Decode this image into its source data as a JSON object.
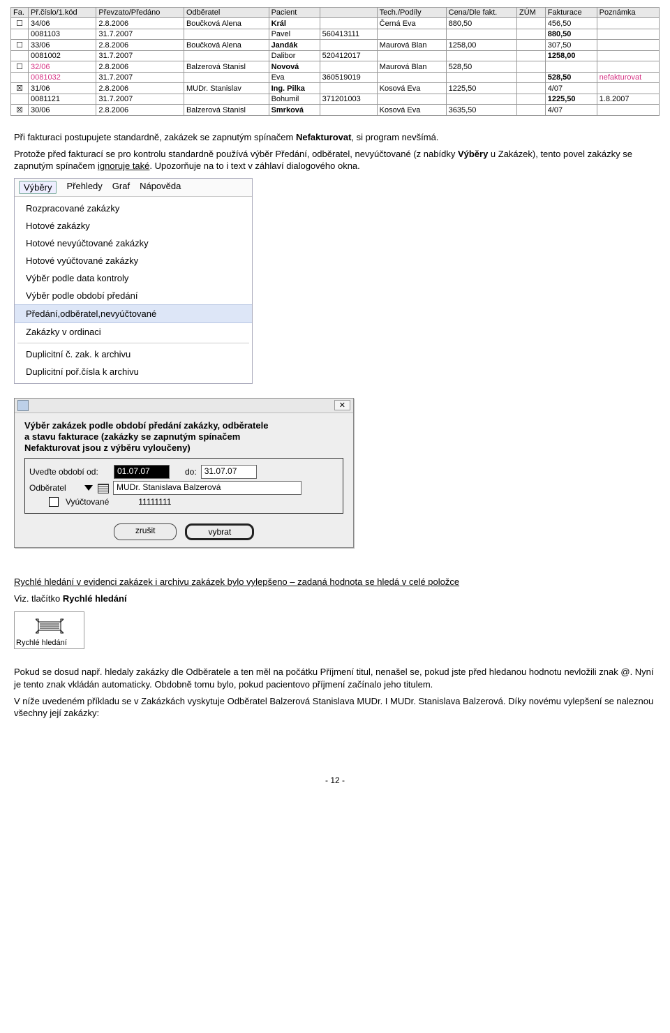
{
  "table": {
    "headers": [
      "Fa.",
      "Př.číslo/1.kód",
      "Převzato/Předáno",
      "Odběratel",
      "Pacient",
      "",
      "Tech./Podíly",
      "Cena/Dle fakt.",
      "ZÚM",
      "Fakturace",
      "Poznámka"
    ],
    "rows": [
      {
        "chk": "☐",
        "c1": "34/06",
        "c2": "2.8.2006",
        "c3": "Boučková Alena",
        "c4": "Král",
        "c5": "",
        "c6": "Černá Eva",
        "c7": "880,50",
        "c8": "",
        "c9": "456,50",
        "c10": "",
        "pink": false,
        "bold4": true
      },
      {
        "chk": "",
        "c1": "0081103",
        "c2": "31.7.2007",
        "c3": "",
        "c4": "Pavel",
        "c5": "560413111",
        "c6": "",
        "c7": "",
        "c8": "",
        "c9": "880,50",
        "c10": "",
        "pink": false,
        "bold9": true
      },
      {
        "chk": "☐",
        "c1": "33/06",
        "c2": "2.8.2006",
        "c3": "Boučková Alena",
        "c4": "Jandák",
        "c5": "",
        "c6": "Maurová Blan",
        "c7": "1258,00",
        "c8": "",
        "c9": "307,50",
        "c10": "",
        "pink": false,
        "bold4": true
      },
      {
        "chk": "",
        "c1": "0081002",
        "c2": "31.7.2007",
        "c3": "",
        "c4": "Dalibor",
        "c5": "520412017",
        "c6": "",
        "c7": "",
        "c8": "",
        "c9": "1258,00",
        "c10": "",
        "pink": false,
        "bold9": true
      },
      {
        "chk": "☐",
        "c1": "32/06",
        "c2": "2.8.2006",
        "c3": "Balzerová Stanisl",
        "c4": "Novová",
        "c5": "",
        "c6": "Maurová Blan",
        "c7": "528,50",
        "c8": "",
        "c9": "",
        "c10": "",
        "pink": true,
        "bold4": true
      },
      {
        "chk": "",
        "c1": "0081032",
        "c2": "31.7.2007",
        "c3": "",
        "c4": "Eva",
        "c5": "360519019",
        "c6": "",
        "c7": "",
        "c8": "",
        "c9": "528,50",
        "c10": "nefakturovat",
        "pink": true,
        "bold9": true
      },
      {
        "chk": "☒",
        "c1": "31/06",
        "c2": "2.8.2006",
        "c3": "MUDr. Stanislav",
        "c4": "Ing. Pilka",
        "c5": "",
        "c6": "Kosová Eva",
        "c7": "1225,50",
        "c8": "",
        "c9": "4/07",
        "c10": "",
        "pink": false,
        "bold4": true
      },
      {
        "chk": "",
        "c1": "0081121",
        "c2": "31.7.2007",
        "c3": "",
        "c4": "Bohumil",
        "c5": "371201003",
        "c6": "",
        "c7": "",
        "c8": "",
        "c9": "1225,50",
        "c10": "1.8.2007",
        "pink": false,
        "bold9": true
      },
      {
        "chk": "☒",
        "c1": "30/06",
        "c2": "2.8.2006",
        "c3": "Balzerová Stanisl",
        "c4": "Smrková",
        "c5": "",
        "c6": "Kosová Eva",
        "c7": "3635,50",
        "c8": "",
        "c9": "4/07",
        "c10": "",
        "pink": false,
        "bold4": true
      }
    ]
  },
  "para1": {
    "a": "Při fakturaci postupujete standardně, zakázek se zapnutým spínačem ",
    "b": "Nefakturovat",
    "c": ", si program nevšímá."
  },
  "para2": {
    "a": "Protože před fakturací se pro kontrolu standardně používá výběr Předání, odběratel, nevyúčtované (z nabídky ",
    "b": "Výběry",
    "c": " u Zakázek), tento povel zakázky se zapnutým spínačem ",
    "d": "ignoruje také",
    "e": ". Upozorňuje na to i text v záhlaví dialogového okna."
  },
  "menu": {
    "bar": [
      "Výběry",
      "Přehledy",
      "Graf",
      "Nápověda"
    ],
    "items": [
      "Rozpracované zakázky",
      "Hotové zakázky",
      "Hotové nevyúčtované zakázky",
      "Hotové vyúčtované zakázky",
      "Výběr podle data kontroly",
      "Výběr podle období předání",
      "Předání,odběratel,nevyúčtované",
      "Zakázky v ordinaci",
      "Duplicitní č. zak. k archivu",
      "Duplicitní poř.čísla k archivu"
    ],
    "hl_index": 6,
    "sep_after": 7
  },
  "dialog": {
    "close": "✕",
    "head1": "Výběr zakázek podle období předání zakázky, odběratele",
    "head2": "a stavu fakturace (zakázky se zapnutým spínačem",
    "head3": "Nefakturovat jsou z výběru vyloučeny)",
    "lbl_od": "Uveďte období od:",
    "val_od": "01.07.07",
    "lbl_do": "do:",
    "val_do": "31.07.07",
    "lbl_odb": "Odběratel",
    "val_odb": "MUDr. Stanislava Balzerová",
    "val_num": "11111111",
    "vyuct": "Vyúčtované",
    "btn_cancel": "zrušit",
    "btn_ok": "vybrat"
  },
  "heading2": "Rychlé hledání v evidenci zakázek i archivu zakázek bylo vylepšeno – zadaná hodnota se hledá v celé položce",
  "para3": {
    "a": "Viz. tlačítko ",
    "b": "Rychlé hledání"
  },
  "quick_label": "Rychlé hledání",
  "para4": "Pokud se dosud např. hledaly zakázky dle Odběratele a ten měl na počátku Příjmení titul, nenašel se, pokud jste před hledanou hodnotu nevložili znak @. Nyní je tento znak vkládán automaticky. Obdobně tomu bylo, pokud pacientovo příjmení začínalo jeho titulem.",
  "para5": "V níže uvedeném příkladu se v Zakázkách vyskytuje Odběratel Balzerová Stanislava MUDr. I MUDr. Stanislava Balzerová. Díky novému vylepšení se naleznou všechny její zakázky:",
  "page": "- 12 -"
}
